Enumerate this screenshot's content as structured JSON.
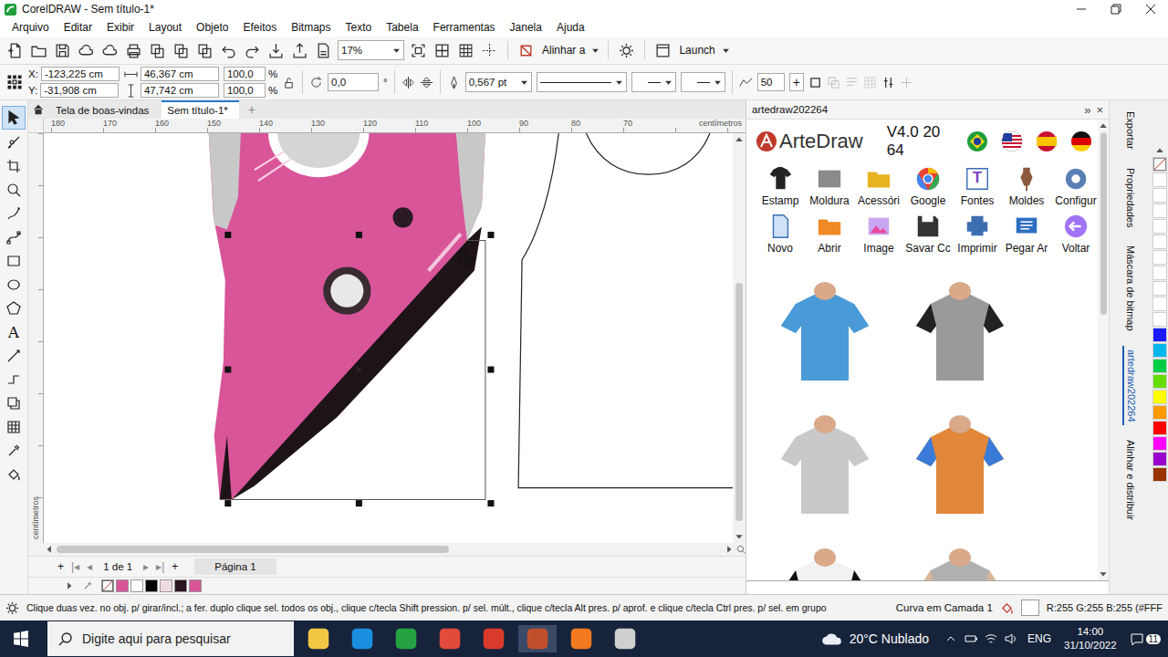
{
  "window": {
    "title": "CorelDRAW - Sem título-1*"
  },
  "menu": [
    "Arquivo",
    "Editar",
    "Exibir",
    "Layout",
    "Objeto",
    "Efeitos",
    "Bitmaps",
    "Texto",
    "Tabela",
    "Ferramentas",
    "Janela",
    "Ajuda"
  ],
  "toolbar": {
    "zoom": "17%",
    "align_label": "Alinhar a",
    "launch_label": "Launch"
  },
  "property_bar": {
    "x_label": "X:",
    "x": "-123,225 cm",
    "y_label": "Y:",
    "y": "-31,908 cm",
    "width": "46,367 cm",
    "height": "47,742 cm",
    "scale_x": "100,0",
    "scale_y": "100,0",
    "percent": "%",
    "rotation": "0,0",
    "degree": "°",
    "outline_width": "0,567 pt",
    "smoothing": "50",
    "smoothing_plus": "+"
  },
  "doc_tabs": [
    {
      "label": "Tela de boas-vindas",
      "selected": false
    },
    {
      "label": "Sem título-1*",
      "selected": true
    }
  ],
  "new_tab": "+",
  "ruler": {
    "labels": [
      "180",
      "170",
      "160",
      "150",
      "140",
      "130",
      "120",
      "110",
      "100",
      "90",
      "80",
      "70"
    ],
    "unit": "centímetros"
  },
  "tools": [
    {
      "kind": "pointer",
      "selected": true
    },
    {
      "kind": "shape",
      "selected": false
    },
    {
      "kind": "crop",
      "selected": false
    },
    {
      "kind": "zoom",
      "selected": false
    },
    {
      "kind": "freehand",
      "selected": false
    },
    {
      "kind": "bezier",
      "selected": false
    },
    {
      "kind": "rect",
      "selected": false
    },
    {
      "kind": "ellipse",
      "selected": false
    },
    {
      "kind": "polygon",
      "selected": false
    },
    {
      "kind": "text",
      "selected": false,
      "glyph": "A"
    },
    {
      "kind": "line",
      "selected": false
    },
    {
      "kind": "connector",
      "selected": false
    },
    {
      "kind": "shadow",
      "selected": false
    },
    {
      "kind": "transparency",
      "selected": false
    },
    {
      "kind": "eyedropper",
      "selected": false
    },
    {
      "kind": "fill",
      "selected": false
    }
  ],
  "page_nav": {
    "add_before": "+",
    "first": "|◂",
    "prev": "◂",
    "page": "1 de 1",
    "next": "▸",
    "last": "▸|",
    "add_after": "+",
    "page_tab": "Página 1"
  },
  "doc_palette": [
    {
      "color": "#d9559a"
    },
    {
      "color": "#ffffff"
    },
    {
      "color": "#000000"
    },
    {
      "color": "#f0dbe4"
    },
    {
      "color": "#2a1620"
    },
    {
      "color": "#d9559a"
    }
  ],
  "docker": {
    "header": "artedraw202264",
    "collapse": "»",
    "close": "×",
    "brand": "ArteDraw",
    "version": "V4.0 20 64",
    "buttons": [
      {
        "label": "Estamp",
        "kind": "shirt"
      },
      {
        "label": "Moldura",
        "kind": "frame"
      },
      {
        "label": "Acessóri",
        "kind": "folder"
      },
      {
        "label": "Google",
        "kind": "google"
      },
      {
        "label": "Fontes",
        "kind": "font",
        "glyph": "T"
      },
      {
        "label": "Moldes",
        "kind": "dress"
      },
      {
        "label": "Configur",
        "kind": "gear"
      },
      {
        "label": "Novo",
        "kind": "new"
      },
      {
        "label": "Abrir",
        "kind": "open"
      },
      {
        "label": "Image",
        "kind": "image"
      },
      {
        "label": "Savar Cc",
        "kind": "save"
      },
      {
        "label": "Imprimir",
        "kind": "print"
      },
      {
        "label": "Pegar Ar",
        "kind": "grab"
      },
      {
        "label": "Voltar",
        "kind": "back"
      }
    ]
  },
  "side_tabs": [
    {
      "label": "Exportar",
      "selected": false
    },
    {
      "label": "Propriedades",
      "selected": false
    },
    {
      "label": "Máscara de bitmap",
      "selected": false
    },
    {
      "label": "artedraw202264",
      "selected": true
    },
    {
      "label": "Alinhar e distribuir",
      "selected": false
    }
  ],
  "palette": [
    {
      "color": "#ffffff"
    },
    {
      "color": "#ffffff"
    },
    {
      "color": "#ffffff"
    },
    {
      "color": "#ffffff"
    },
    {
      "color": "#ffffff"
    },
    {
      "color": "#ffffff"
    },
    {
      "color": "#ffffff"
    },
    {
      "color": "#ffffff"
    },
    {
      "color": "#ffffff"
    },
    {
      "color": "#ffffff"
    },
    {
      "color": "#1a1aff"
    },
    {
      "color": "#00b7eb"
    },
    {
      "color": "#00cc44"
    },
    {
      "color": "#66dd00"
    },
    {
      "color": "#ffff00"
    },
    {
      "color": "#ff9900"
    },
    {
      "color": "#ff0000"
    },
    {
      "color": "#ff00ff"
    },
    {
      "color": "#9900cc"
    },
    {
      "color": "#993300"
    }
  ],
  "status_bar": {
    "hint": "Clique duas vez. no obj. p/ girar/incl.; a fer. duplo clique sel. todos os obj., clique c/tecla Shift pression. p/ sel. múlt., clique c/tecla Alt pres. p/ aprof. e clique c/tecla Ctrl pres. p/ sel. em grupo",
    "object": "Curva em Camada 1",
    "color_info": "R:255 G:255 B:255 (#FFF"
  },
  "taskbar": {
    "search_placeholder": "Digite aqui para pesquisar",
    "weather": "20°C Nublado",
    "language": "ENG",
    "time": "14:00",
    "date": "31/10/2022",
    "notifications": "11"
  }
}
